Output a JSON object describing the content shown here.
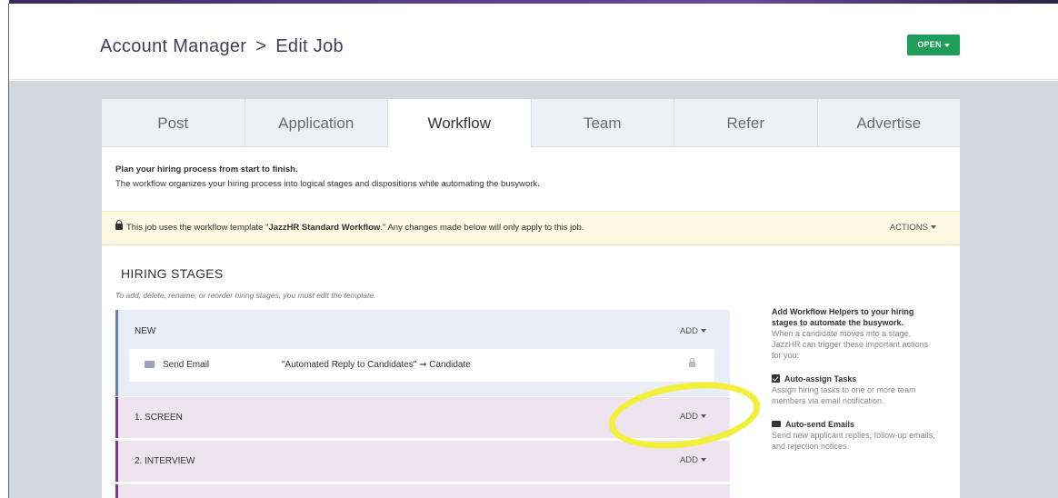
{
  "header": {
    "breadcrumb_root": "Account Manager",
    "separator": ">",
    "title": "Edit Job",
    "status_button": "OPEN"
  },
  "tabs": [
    {
      "label": "Post"
    },
    {
      "label": "Application"
    },
    {
      "label": "Workflow",
      "active": true
    },
    {
      "label": "Team"
    },
    {
      "label": "Refer"
    },
    {
      "label": "Advertise"
    }
  ],
  "intro": {
    "heading": "Plan your hiring process from start to finish.",
    "text": "The workflow organizes your hiring process into logical stages and dispositions while automating the busywork."
  },
  "banner": {
    "text_before": "This job uses the workflow template \"",
    "template_name": "JazzHR Standard Workflow",
    "text_after": ".\" Any changes made below will only apply to this job.",
    "actions_label": "ACTIONS"
  },
  "hiring_stages": {
    "title": "HIRING STAGES",
    "subtitle": "To add, delete, rename, or reorder hiring stages, you must edit the template.",
    "stages": [
      {
        "name": "NEW",
        "add_label": "ADD",
        "helpers": [
          {
            "label": "Send Email",
            "detail": "\"Automated Reply to Candidates\" ➞ Candidate"
          }
        ]
      },
      {
        "name": "1. SCREEN",
        "add_label": "ADD"
      },
      {
        "name": "2. INTERVIEW",
        "add_label": "ADD"
      }
    ]
  },
  "sidebar": {
    "title": "Add Workflow Helpers to your hiring stages to automate the busywork.",
    "description": "When a candidate moves into a stage, JazzHR can trigger these important actions for you:",
    "items": [
      {
        "title": "Auto-assign Tasks",
        "icon": "checkbox-icon",
        "description": "Assign hiring tasks to one or more team members via email notification."
      },
      {
        "title": "Auto-send Emails",
        "icon": "envelope-icon",
        "description": "Send new applicant replies, follow-up emails, and rejection notices."
      }
    ]
  },
  "colors": {
    "open_button": "#1e9e58",
    "banner_bg": "#fdf8e1",
    "stage_new_bg": "#e9edf6",
    "stage_other_bg": "#ede4f0",
    "highlight": "#f2f03a"
  }
}
